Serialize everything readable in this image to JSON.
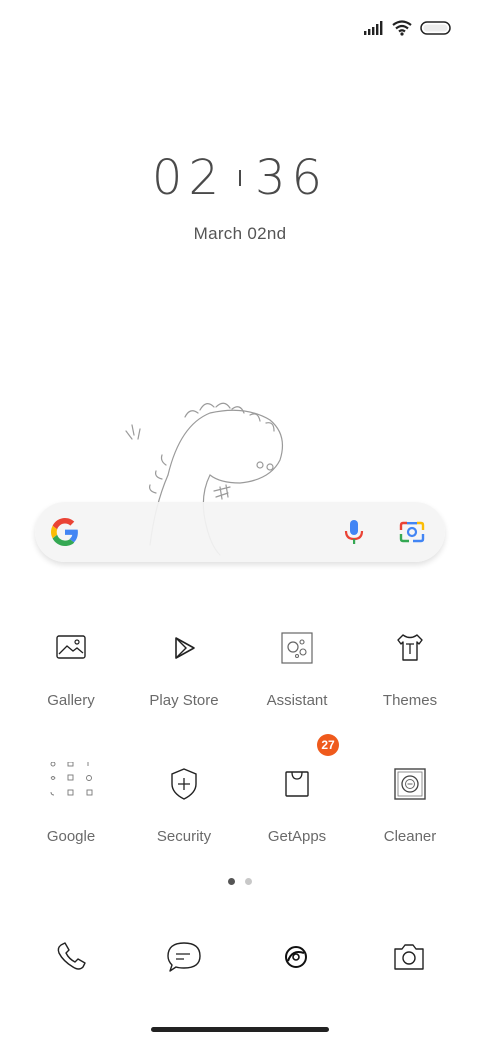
{
  "clock": {
    "hour": "02",
    "minute": "36",
    "date": "March  02nd"
  },
  "search": {
    "engine_icon": "google-g-icon",
    "mic_icon": "microphone-icon",
    "lens_icon": "google-lens-icon"
  },
  "apps": [
    {
      "label": "Gallery",
      "icon": "gallery-icon"
    },
    {
      "label": "Play Store",
      "icon": "play-store-icon"
    },
    {
      "label": "Assistant",
      "icon": "assistant-icon"
    },
    {
      "label": "Themes",
      "icon": "themes-icon"
    },
    {
      "label": "Google",
      "icon": "google-folder-icon"
    },
    {
      "label": "Security",
      "icon": "security-icon"
    },
    {
      "label": "GetApps",
      "icon": "getapps-icon",
      "badge": "27"
    },
    {
      "label": "Cleaner",
      "icon": "cleaner-icon"
    }
  ],
  "page_indicator": {
    "pages": 2,
    "current": 1
  },
  "dock": [
    {
      "icon": "phone-icon"
    },
    {
      "icon": "messages-icon"
    },
    {
      "icon": "browser-icon"
    },
    {
      "icon": "camera-icon"
    }
  ],
  "colors": {
    "badge": "#ef5a1c",
    "text": "#6a6a6a",
    "background": "#ffffff"
  }
}
